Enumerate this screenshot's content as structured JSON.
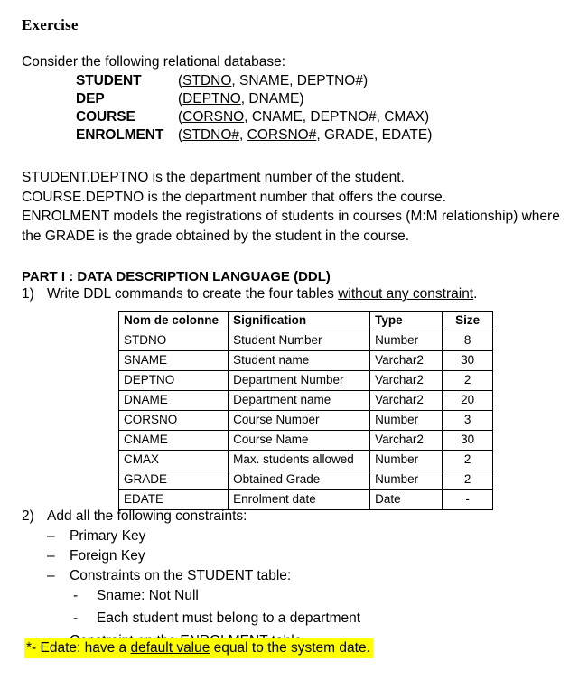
{
  "document": {
    "heading": "Exercise",
    "intro": "Consider the following relational database:",
    "schema": [
      {
        "name": "STUDENT",
        "open": "(",
        "key": "STDNO",
        "rest": ", SNAME, DEPTNO#)"
      },
      {
        "name": "DEP",
        "open": "(",
        "key": "DEPTNO",
        "rest": ", DNAME)"
      },
      {
        "name": "COURSE",
        "open": "(",
        "key": "CORSNO",
        "rest": ", CNAME, DEPTNO#, CMAX)"
      },
      {
        "name": "ENROLMENT",
        "open": "(",
        "key": "STDNO#",
        "mid": ", ",
        "key2": "CORSNO#",
        "rest": ", GRADE, EDATE)"
      }
    ],
    "description": [
      "STUDENT.DEPTNO is the department number of the student.",
      "COURSE.DEPTNO is the department number that offers the course.",
      "ENROLMENT models the registrations of students in courses (M:M relationship) where",
      "the GRADE is the grade obtained by the student in the course."
    ],
    "part1": {
      "heading": "PART I : DATA DESCRIPTION LANGUAGE (DDL)",
      "q1_number": "1)",
      "q1_text_before": "Write DDL commands to create the four tables ",
      "q1_underlined": "without any constraint",
      "q1_text_after": "."
    },
    "table": {
      "headers": [
        "Nom de colonne",
        "Signification",
        "Type",
        "Size"
      ],
      "rows": [
        {
          "name": "STDNO",
          "signification": "Student Number",
          "type": "Number",
          "size": "8"
        },
        {
          "name": "SNAME",
          "signification": "Student name",
          "type": "Varchar2",
          "size": "30"
        },
        {
          "name": "DEPTNO",
          "signification": "Department Number",
          "type": "Varchar2",
          "size": "2"
        },
        {
          "name": "DNAME",
          "signification": "Department name",
          "type": "Varchar2",
          "size": "20"
        },
        {
          "name": "CORSNO",
          "signification": "Course Number",
          "type": "Number",
          "size": "3"
        },
        {
          "name": "CNAME",
          "signification": "Course Name",
          "type": "Varchar2",
          "size": "30"
        },
        {
          "name": "CMAX",
          "signification": "Max. students allowed",
          "type": "Number",
          "size": "2"
        },
        {
          "name": "GRADE",
          "signification": "Obtained Grade",
          "type": "Number",
          "size": "2"
        },
        {
          "name": "EDATE",
          "signification": "Enrolment date",
          "type": "Date",
          "size": "-"
        }
      ]
    },
    "part2": {
      "q2_number": "2)",
      "q2_text": "Add all the following  constraints:",
      "level1_dash": "–",
      "level2_dash": "-",
      "items": [
        "Primary Key",
        "Foreign Key",
        "Constraints on the STUDENT table:"
      ],
      "subitems": [
        "Sname: Not Null",
        "Each student must belong to a department"
      ],
      "item_last": "Constraint on the ENROLMENT table"
    },
    "highlight": {
      "prefix": "*- Edate: have a ",
      "underlined": "default value",
      "suffix": " equal to the system date.",
      "color": "#FFFF00"
    }
  }
}
